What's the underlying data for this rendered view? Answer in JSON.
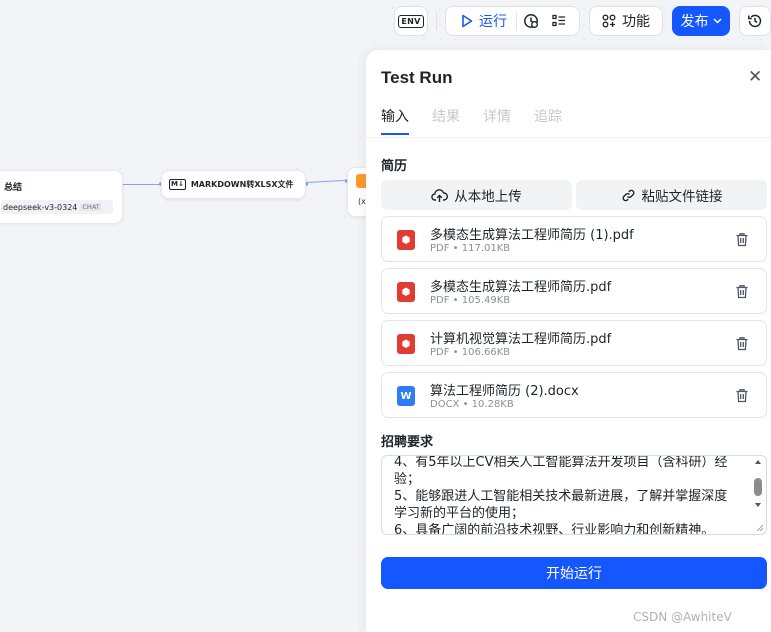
{
  "toolbar": {
    "env_label": "ENV",
    "run_label": "运行",
    "features_label": "功能",
    "publish_label": "发布"
  },
  "canvas": {
    "node_summary": {
      "title": "总结",
      "model": "deepseek-v3-0324",
      "model_tag": "CHAT"
    },
    "node_markdown": {
      "title": "MARKDOWN转XLSX文件",
      "icon_label": "M↓"
    },
    "node_partial": {
      "text": "(x"
    }
  },
  "panel": {
    "title": "Test Run",
    "tabs": [
      "输入",
      "结果",
      "详情",
      "追踪"
    ],
    "active_tab": "输入",
    "resume": {
      "label": "简历",
      "upload_local": "从本地上传",
      "paste_link": "粘贴文件链接",
      "files": [
        {
          "name": "多模态生成算法工程师简历 (1).pdf",
          "meta": "PDF • 117.01KB",
          "type": "pdf"
        },
        {
          "name": "多模态生成算法工程师简历.pdf",
          "meta": "PDF • 105.49KB",
          "type": "pdf"
        },
        {
          "name": "计算机视觉算法工程师简历.pdf",
          "meta": "PDF • 106.66KB",
          "type": "pdf"
        },
        {
          "name": "算法工程师简历 (2).docx",
          "meta": "DOCX • 10.28KB",
          "type": "docx"
        }
      ]
    },
    "requirements": {
      "label": "招聘要求",
      "lines": [
        "4、有5年以上CV相关人工智能算法开发项目（含科研）经验；",
        "5、能够跟进人工智能相关技术最新进展，了解并掌握深度学习新的平台的使用；",
        "6、具备广阔的前沿技术视野、行业影响力和创新精神。"
      ]
    },
    "start_button": "开始运行"
  },
  "watermark": "CSDN @AwhiteV",
  "colors": {
    "accent": "#1557ff",
    "pdf": "#e03c31",
    "docx": "#2f7cf6"
  }
}
